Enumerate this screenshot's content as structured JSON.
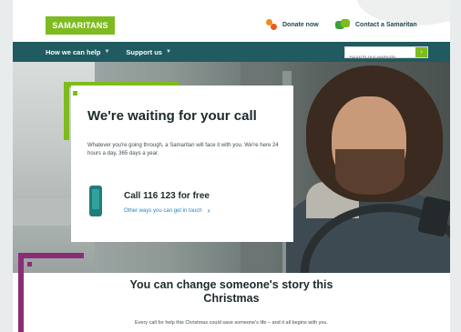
{
  "header": {
    "logo_text": "SAMARITANS",
    "donate_label": "Donate now",
    "contact_label": "Contact a Samaritan"
  },
  "nav": {
    "items": [
      {
        "label": "How we can help"
      },
      {
        "label": "Support us"
      }
    ],
    "search_placeholder": "Search our website"
  },
  "hero": {
    "title": "We're waiting for your call",
    "lead": "Whatever you're going through, a Samaritan will face it with you. We're here 24 hours a day, 365 days a year.",
    "call_title": "Call 116 123 for free",
    "call_link": "Other ways you can get in touch"
  },
  "section": {
    "title": "You can change someone's story this Christmas",
    "lead": "Every call for help this Christmas could save someone's life – and it all begins with you."
  },
  "colors": {
    "brand_green": "#7dbb1f",
    "nav_teal": "#1f5b60",
    "accent_purple": "#8a2d77",
    "link_blue": "#2a84c4"
  }
}
